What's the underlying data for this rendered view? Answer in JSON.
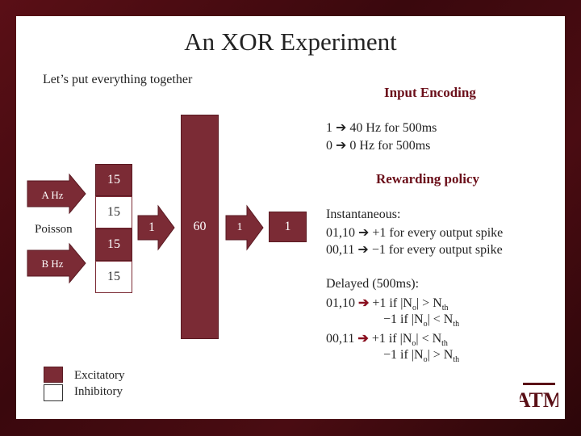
{
  "title": "An XOR Experiment",
  "subtitle": "Let’s put everything together",
  "diagram": {
    "input_a": "A Hz",
    "input_b": "B Hz",
    "poisson": "Poisson",
    "layer1": [
      "15",
      "15",
      "15",
      "15"
    ],
    "arrow1": "1",
    "hidden": "60",
    "arrow2": "1",
    "output": "1"
  },
  "legend": {
    "excitatory": "Excitatory",
    "inhibitory": "Inhibitory"
  },
  "input_encoding": {
    "heading": "Input Encoding",
    "line1": "1 ➔ 40 Hz for 500ms",
    "line2": "0 ➔    0 Hz for 500ms"
  },
  "rewarding_policy": {
    "heading": "Rewarding policy",
    "instantaneous_label": "Instantaneous:",
    "inst1": "01,10 ➔ +1 for every output spike",
    "inst2": "00,11 ➔ −1 for every output spike",
    "delayed_label": "Delayed (500ms):",
    "d1_prefix": "01,10",
    "d1_text": "+1 if |N",
    "d1_rel": "| > N",
    "d2_text": "−1 if |N",
    "d2_rel": "| < N",
    "d3_prefix": "00,11",
    "d3_text": "+1 if |N",
    "d3_rel": "| < N",
    "d4_text": "−1 if |N",
    "d4_rel": "| > N",
    "sub_o": "o",
    "sub_th": "th"
  },
  "logo": "ATM",
  "colors": {
    "maroon": "#7b2b35",
    "accent": "#6b0f1a"
  }
}
